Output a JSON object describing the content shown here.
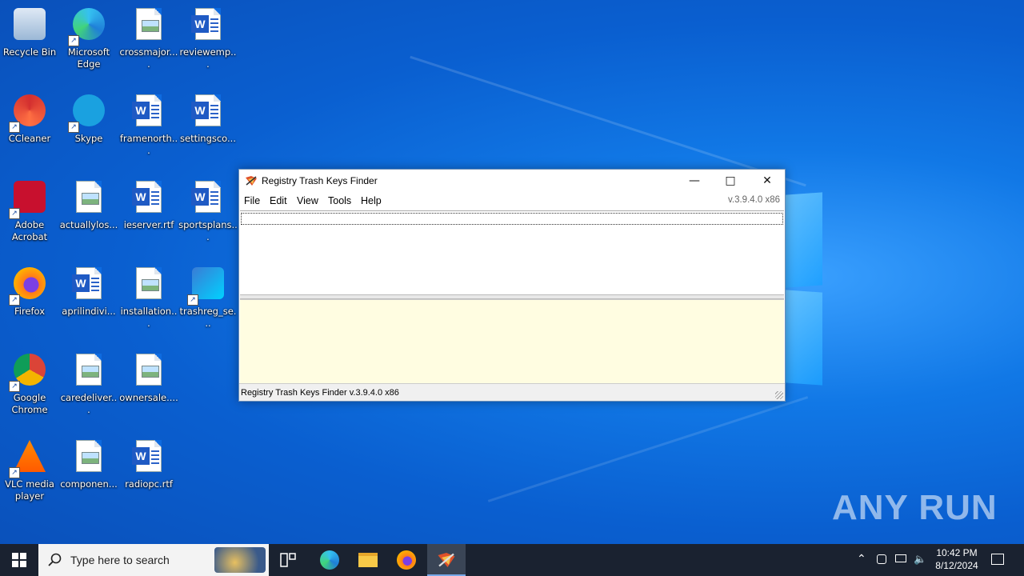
{
  "desktop": {
    "icons": [
      {
        "label": "Recycle Bin",
        "icon": "recycle-bin-icon"
      },
      {
        "label": "Microsoft Edge",
        "icon": "edge-icon"
      },
      {
        "label": "crossmajor....",
        "icon": "image-file-icon"
      },
      {
        "label": "reviewemp...",
        "icon": "word-file-icon"
      },
      {
        "label": "CCleaner",
        "icon": "ccleaner-icon"
      },
      {
        "label": "Skype",
        "icon": "skype-icon"
      },
      {
        "label": "framenorth...",
        "icon": "word-file-icon"
      },
      {
        "label": "settingsco...",
        "icon": "word-file-icon"
      },
      {
        "label": "Adobe Acrobat",
        "icon": "acrobat-icon"
      },
      {
        "label": "actuallylos...",
        "icon": "image-file-icon"
      },
      {
        "label": "ieserver.rtf",
        "icon": "word-file-icon"
      },
      {
        "label": "sportsplans...",
        "icon": "word-file-icon"
      },
      {
        "label": "Firefox",
        "icon": "firefox-icon"
      },
      {
        "label": "aprilindivi...",
        "icon": "word-file-icon"
      },
      {
        "label": "installation...",
        "icon": "image-file-icon"
      },
      {
        "label": "trashreg_se...",
        "icon": "installer-icon"
      },
      {
        "label": "Google Chrome",
        "icon": "chrome-icon"
      },
      {
        "label": "caredeliver...",
        "icon": "image-file-icon"
      },
      {
        "label": "ownersale....",
        "icon": "image-file-icon"
      },
      {
        "label": "VLC media player",
        "icon": "vlc-icon"
      },
      {
        "label": "componen...",
        "icon": "image-file-icon"
      },
      {
        "label": "radiopc.rtf",
        "icon": "word-file-icon"
      }
    ]
  },
  "window": {
    "title": "Registry Trash Keys Finder",
    "menu": [
      "File",
      "Edit",
      "View",
      "Tools",
      "Help"
    ],
    "version": "v.3.9.4.0 x86",
    "status": "Registry Trash Keys Finder v.3.9.4.0 x86"
  },
  "taskbar": {
    "search_placeholder": "Type here to search",
    "time": "10:42 PM",
    "date": "8/12/2024"
  },
  "watermark": "ANY RUN"
}
